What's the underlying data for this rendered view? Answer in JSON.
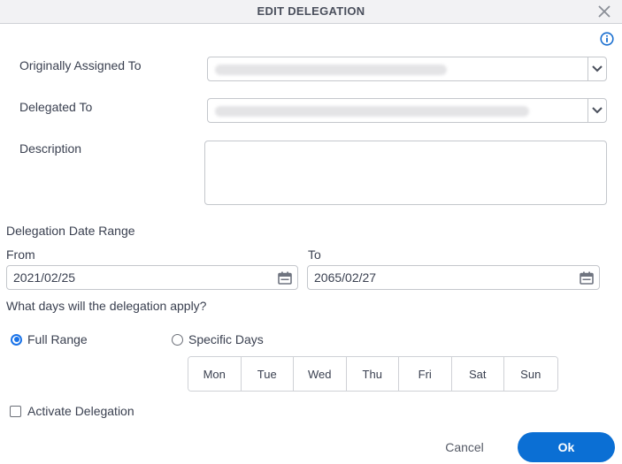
{
  "dialog": {
    "title": "EDIT DELEGATION",
    "close_icon": "close-icon",
    "info_icon": "info-icon"
  },
  "fields": {
    "originally_assigned_to": {
      "label": "Originally Assigned To",
      "value": ""
    },
    "delegated_to": {
      "label": "Delegated To",
      "value": ""
    },
    "description": {
      "label": "Description",
      "value": ""
    }
  },
  "date_range": {
    "heading": "Delegation Date Range",
    "from_label": "From",
    "from_value": "2021/02/25",
    "to_label": "To",
    "to_value": "2065/02/27"
  },
  "days": {
    "question": "What days will the delegation apply?",
    "options": [
      {
        "label": "Full Range",
        "selected": true
      },
      {
        "label": "Specific Days",
        "selected": false
      }
    ],
    "weekdays": [
      "Mon",
      "Tue",
      "Wed",
      "Thu",
      "Fri",
      "Sat",
      "Sun"
    ]
  },
  "activate": {
    "label": "Activate Delegation",
    "checked": false
  },
  "buttons": {
    "cancel": "Cancel",
    "ok": "Ok"
  },
  "colors": {
    "accent": "#0b6fd4",
    "radio": "#1a73e8",
    "titlebar": "#f2f2f4"
  }
}
